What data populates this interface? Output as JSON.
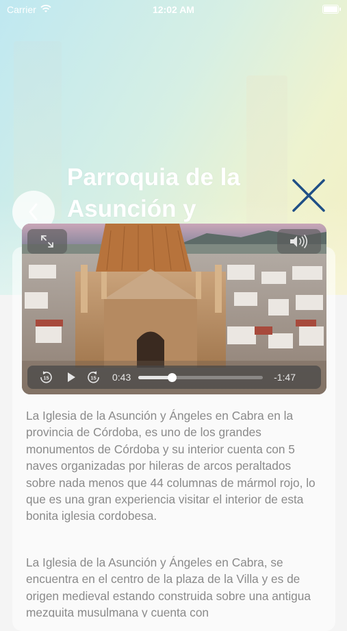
{
  "status_bar": {
    "carrier": "Carrier",
    "time": "12:02 AM"
  },
  "header": {
    "title": "Parroquia de la Asunción y Ángeles"
  },
  "icons": {
    "wifi": "wifi-icon",
    "battery": "battery-icon",
    "back": "chevron-left-icon",
    "close": "close-x-icon",
    "expand": "expand-icon",
    "volume": "volume-icon",
    "rewind": "skip-back-15-icon",
    "play": "play-icon",
    "forward": "skip-forward-15-icon"
  },
  "video": {
    "current_time": "0:43",
    "remaining_time": "-1:47",
    "progress": 0.27,
    "skip_back_label": "15",
    "skip_forward_label": "15"
  },
  "colors": {
    "close_icon": "#1f4f86",
    "body_text": "#8a8a8a",
    "title": "#ffffff"
  },
  "content": {
    "paragraph1": "La Iglesia de la Asunción y Ángeles en Cabra en la provincia de Córdoba, es uno de los grandes monumentos de Córdoba y su interior cuenta con 5 naves organizadas por hileras de arcos peraltados sobre nada menos que 44 columnas de mármol rojo, lo que es una gran experiencia visitar el interior de esta bonita iglesia cordobesa.",
    "paragraph2": "La Iglesia de la Asunción y Ángeles en Cabra, se encuentra en el centro de la plaza de la Villa y es de origen medieval estando construida sobre una antigua mezquita musulmana y cuenta con"
  }
}
